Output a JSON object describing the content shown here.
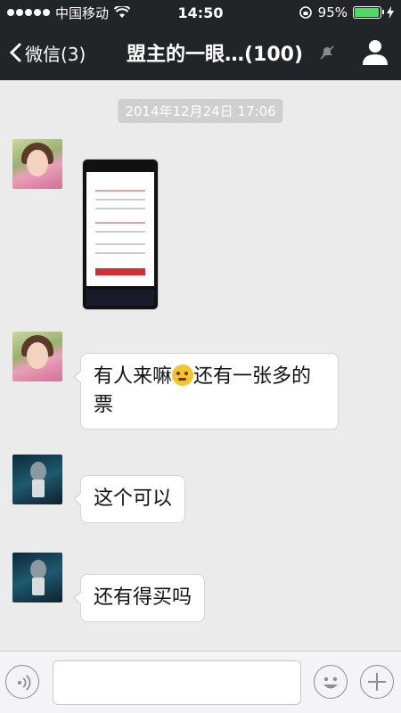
{
  "status_bar": {
    "carrier": "中国移动",
    "time": "14:50",
    "battery_percent": "95%",
    "battery_level": 0.95
  },
  "nav": {
    "back_label": "微信(3)",
    "title": "盟主的一眼…(100)"
  },
  "chat": {
    "timestamp": "2014年12月24日 17:06",
    "messages": [
      {
        "sender": "girl",
        "type": "image"
      },
      {
        "sender": "girl",
        "type": "text",
        "text_before": "有人来嘛",
        "text_after": "还有一张多的票"
      },
      {
        "sender": "boy",
        "type": "text",
        "text": "这个可以"
      },
      {
        "sender": "boy",
        "type": "text",
        "text": "还有得买吗"
      }
    ]
  },
  "input_bar": {
    "placeholder": ""
  },
  "colors": {
    "nav_background": "#222528",
    "chat_background": "#ebebeb",
    "battery_fill": "#4cd964"
  },
  "icons": [
    "back-chevron-icon",
    "mute-icon",
    "profile-icon",
    "voice-icon",
    "emoji-icon",
    "plus-icon",
    "wifi-icon",
    "battery-icon"
  ]
}
